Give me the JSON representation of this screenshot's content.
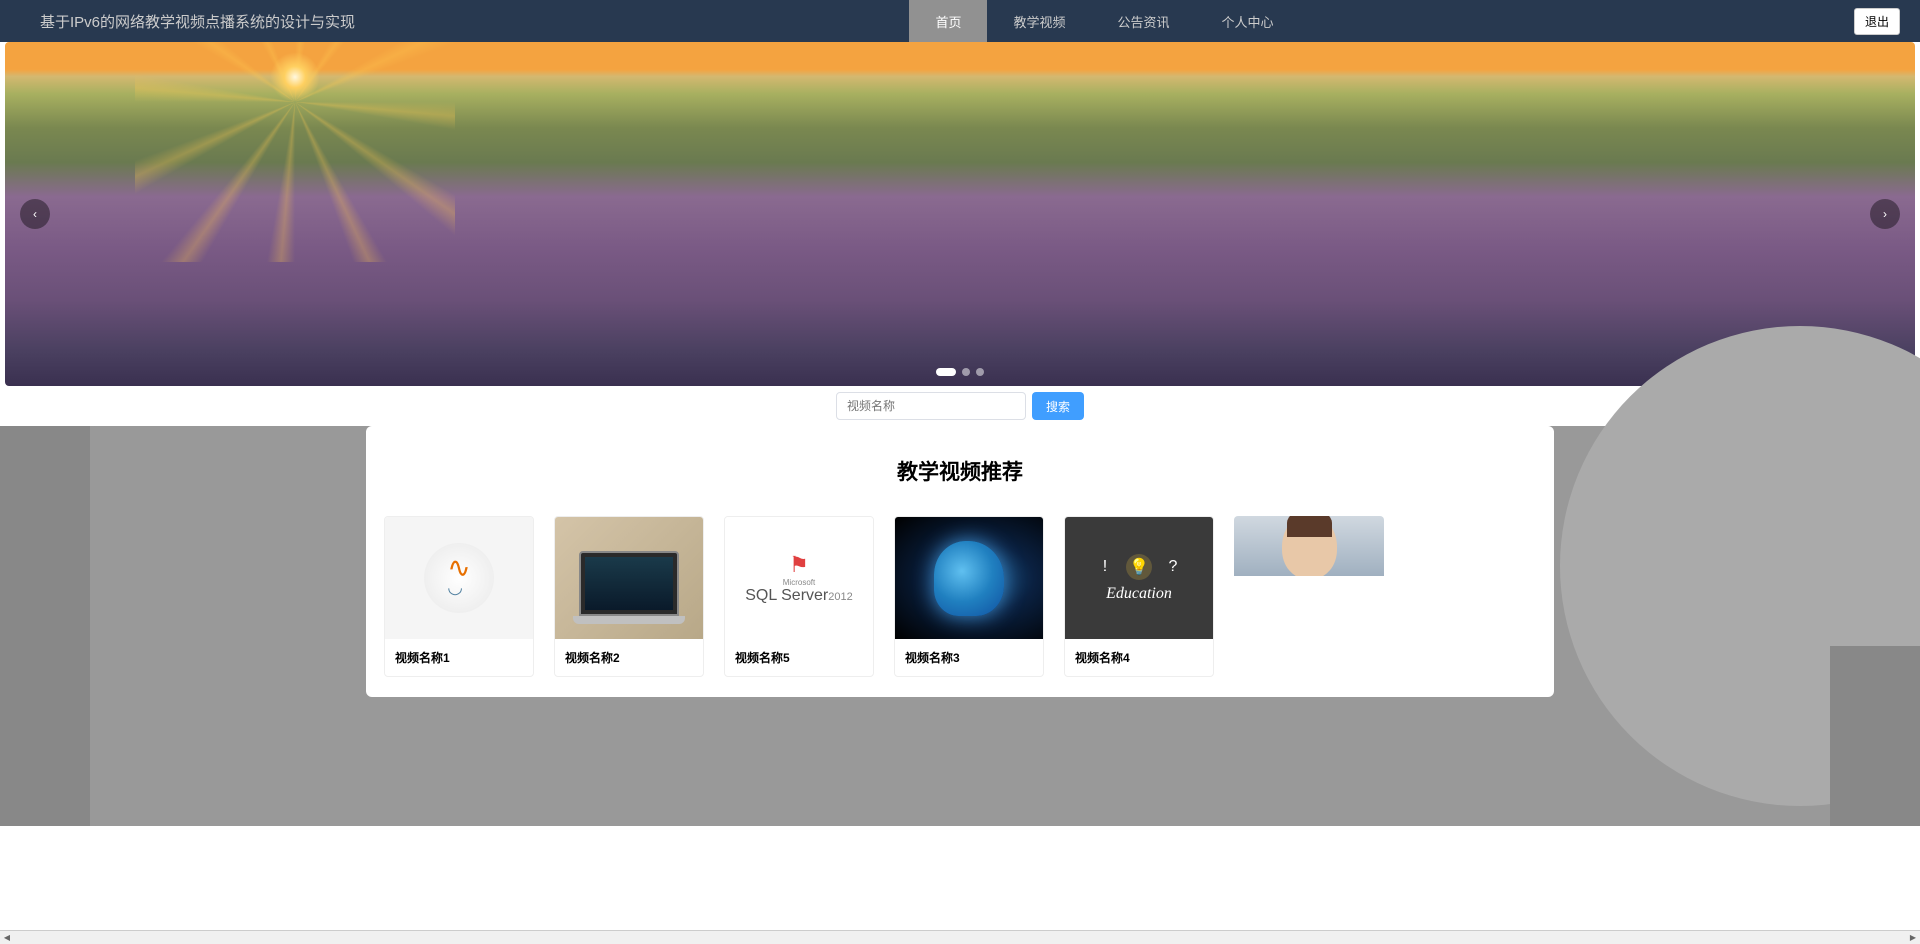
{
  "header": {
    "title": "基于IPv6的网络教学视频点播系统的设计与实现",
    "logout_label": "退出"
  },
  "nav": {
    "items": [
      {
        "label": "首页",
        "active": true
      },
      {
        "label": "教学视频",
        "active": false
      },
      {
        "label": "公告资讯",
        "active": false
      },
      {
        "label": "个人中心",
        "active": false
      }
    ]
  },
  "carousel": {
    "slide_count": 3,
    "active_index": 0
  },
  "search": {
    "placeholder": "视频名称",
    "button_label": "搜索"
  },
  "section": {
    "title": "教学视频推荐"
  },
  "videos": [
    {
      "title": "视频名称1",
      "thumb_type": "java"
    },
    {
      "title": "视频名称2",
      "thumb_type": "laptop"
    },
    {
      "title": "视频名称5",
      "thumb_type": "sql"
    },
    {
      "title": "视频名称3",
      "thumb_type": "brain"
    },
    {
      "title": "视频名称4",
      "thumb_type": "edu"
    },
    {
      "title": "",
      "thumb_type": "matrix"
    }
  ]
}
